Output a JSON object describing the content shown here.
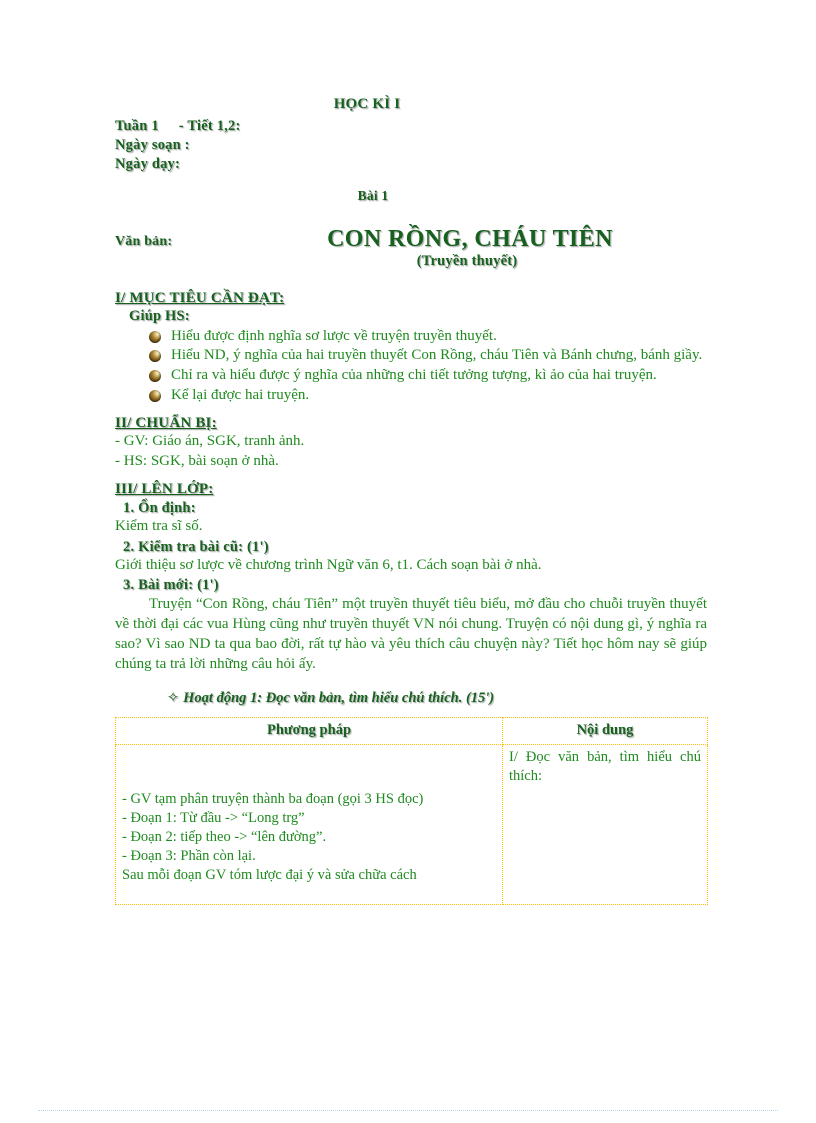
{
  "document": {
    "header_center": "HỌC KÌ I",
    "week_label": "Tuần 1",
    "period_label": "- Tiết 1,2:",
    "date_prepared": "Ngày soạn :",
    "date_taught": "Ngày dạy:",
    "lesson_number": "Bài 1",
    "text_type_label": "Văn bản:",
    "title": "CON RỒNG, CHÁU TIÊN",
    "subtitle": "(Truyền thuyết)"
  },
  "section_1": {
    "heading": "I/ MỤC TIÊU CẦN ĐẠT:",
    "subheading": "Giúp HS:",
    "objectives": [
      "Hiểu được định nghĩa sơ lược về truyện truyền thuyết.",
      "Hiểu ND, ý nghĩa của hai truyền thuyết Con Rồng, cháu Tiên và Bánh chưng, bánh giầy.",
      "Chỉ ra và hiểu được ý nghĩa của những chi tiết tưởng tượng, kì ảo của hai truyện.",
      "Kể lại được hai truyện."
    ]
  },
  "section_2": {
    "heading": "II/ CHUẨN BỊ:",
    "items": [
      "- GV: Giáo án, SGK, tranh ảnh.",
      "- HS: SGK, bài soạn ở nhà."
    ]
  },
  "section_3": {
    "heading": "III/ LÊN LỚP:",
    "step_1_title": "1. Ổn định:",
    "step_1_body": "Kiểm tra sĩ số.",
    "step_2_title": "2. Kiểm tra bài cũ: (1')",
    "step_2_body": "Giới thiệu sơ lược về chương trình Ngữ văn 6, t1. Cách soạn bài ở nhà.",
    "step_3_title": "3. Bài mới: (1')",
    "step_3_body": "Truyện “Con Rồng, cháu Tiên” một truyền thuyết tiêu biểu, mở đầu cho chuỗi truyền thuyết về thời đại các vua Hùng cũng như truyền thuyết VN nói chung. Truyện có nội dung gì, ý nghĩa ra sao? Vì sao ND ta qua bao đời, rất tự hào và yêu thích câu chuyện này? Tiết học hôm nay sẽ giúp chúng ta trả lời những câu hỏi ấy."
  },
  "activity": {
    "bullet_glyph": "✧",
    "heading": "Hoạt động 1: Đọc văn bản, tìm hiểu chú thích. (15')"
  },
  "table": {
    "headers": {
      "left": "Phương pháp",
      "right": "Nội dung"
    },
    "left_cell_lines": [
      "- GV tạm phân truyện thành ba đoạn (gọi 3 HS đọc)",
      "- Đoạn 1: Từ đầu -> “Long trg”",
      "- Đoạn 2: tiếp theo -> “lên đường”.",
      "- Đoạn 3: Phần còn lại.",
      "Sau mỗi đoạn GV tóm lược đại ý và sửa chữa cách"
    ],
    "right_cell_lines": [
      "I/ Đọc văn bản, tìm hiểu chú thích:"
    ]
  },
  "colors": {
    "heading_green": "#17611f",
    "body_green": "#1f8a1f",
    "table_border": "#ffc000",
    "bullet_bronze": "#a8812f",
    "footer_rule": "#bcd8ea"
  }
}
